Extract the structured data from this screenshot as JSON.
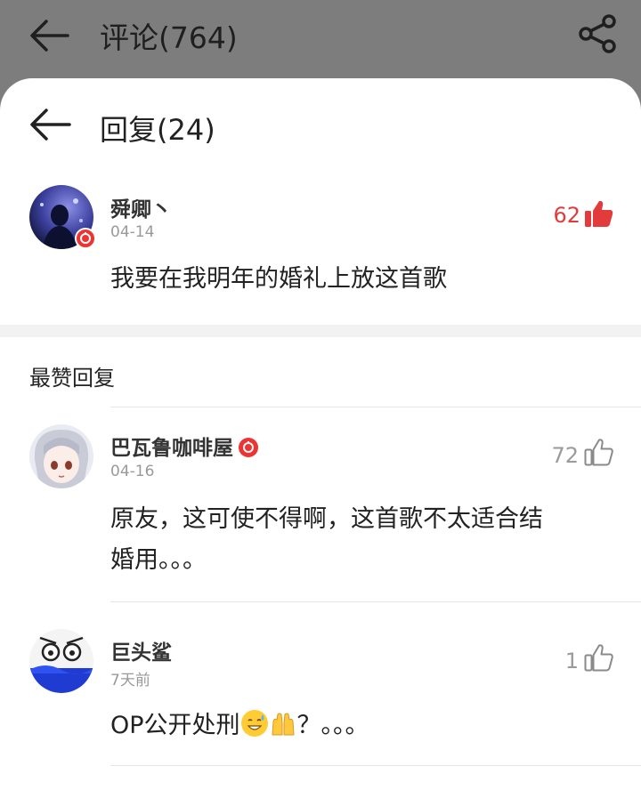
{
  "header": {
    "title": "评论(764)"
  },
  "reply_sheet": {
    "title": "回复(24)",
    "original_comment": {
      "username": "舜卿丶",
      "date": "04-14",
      "content": "我要在我明年的婚礼上放这首歌",
      "like_count": "62",
      "liked": true
    },
    "section_title": "最赞回复",
    "replies": [
      {
        "username": "巴瓦鲁咖啡屋",
        "date": "04-16",
        "content_line1": "原友，这可使不得啊，这首歌不太适合结",
        "content_line2": "婚用。。。",
        "like_count": "72",
        "vip": true
      },
      {
        "username": "巨头鲨",
        "date": "7天前",
        "content_prefix": "OP公开处刑",
        "content_suffix": "？。。。",
        "like_count": "1",
        "vip": false
      }
    ]
  },
  "colors": {
    "accent_red": "#e33b3b",
    "overlay_gray": "#7d7d7d",
    "muted_text": "#9a9a9a"
  },
  "icons": [
    "back-arrow-icon",
    "share-icon",
    "thumbs-up-icon",
    "vip-music-badge-icon",
    "sweat-smile-emoji",
    "raised-hands-emoji"
  ]
}
